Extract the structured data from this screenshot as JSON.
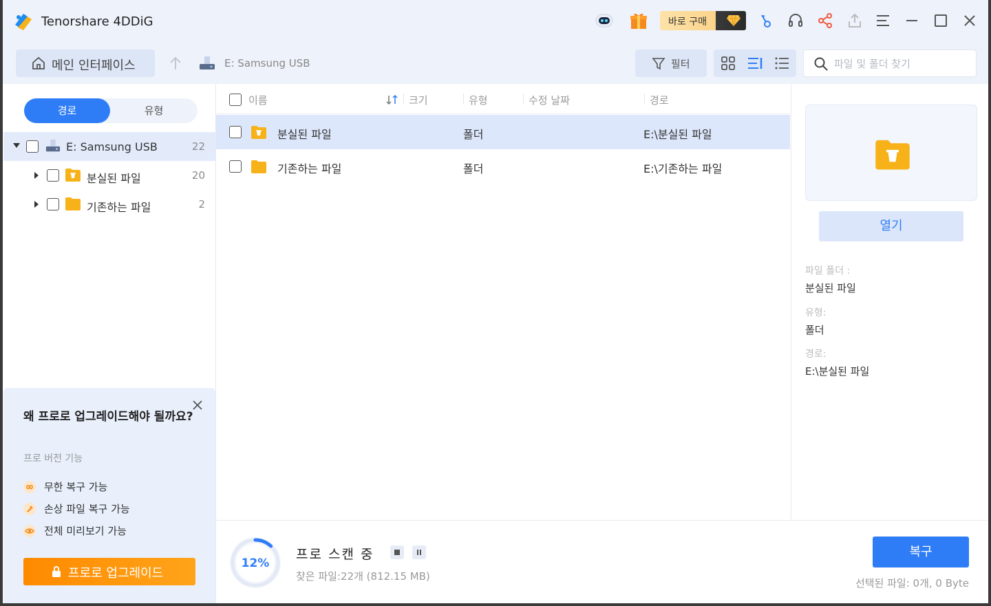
{
  "app": {
    "title": "Tenorshare 4DDiG",
    "buy_label": "바로 구매"
  },
  "toolbar": {
    "home_label": "메인 인터페이스",
    "breadcrumb": "E: Samsung USB",
    "filter_label": "필터",
    "search_placeholder": "파일 및 폴더 찾기"
  },
  "sidebar": {
    "tabs": [
      "경로",
      "유형"
    ],
    "tree": [
      {
        "label": "E: Samsung USB",
        "count": "22"
      },
      {
        "label": "분실된 파일",
        "count": "20"
      },
      {
        "label": "기존하는 파일",
        "count": "2"
      }
    ]
  },
  "promo": {
    "title": "왜 프로로 업그레이드해야 될까요?",
    "subtitle": "프로 버전 기능",
    "features": [
      "무한 복구 가능",
      "손상 파일 복구 가능",
      "전체 미리보기 가능"
    ],
    "button_label": "프로로 업그레이드"
  },
  "file_list": {
    "columns": [
      "이름",
      "크기",
      "유형",
      "수정 날짜",
      "경로"
    ],
    "rows": [
      {
        "name": "분실된 파일",
        "size": "",
        "type": "폴더",
        "modified": "",
        "path": "E:\\분실된 파일"
      },
      {
        "name": "기존하는 파일",
        "size": "",
        "type": "폴더",
        "modified": "",
        "path": "E:\\기존하는 파일"
      }
    ]
  },
  "details": {
    "open_label": "열기",
    "folder_key": "파일 폴더 :",
    "folder_val": "분실된 파일",
    "type_key": "유형:",
    "type_val": "폴더",
    "path_key": "경로:",
    "path_val": "E:\\분실된 파일"
  },
  "scan": {
    "percent_label": "12%",
    "progress": 0.12,
    "status": "프로 스캔 중",
    "found": "찾은 파일:22개 (812.15 MB)"
  },
  "footer": {
    "recover_label": "복구",
    "selected": "선택된 파일: 0개, 0 Byte"
  },
  "colors": {
    "accent": "#2f7df6",
    "orange": "#ff8a00",
    "folder": "#f7b21a"
  }
}
